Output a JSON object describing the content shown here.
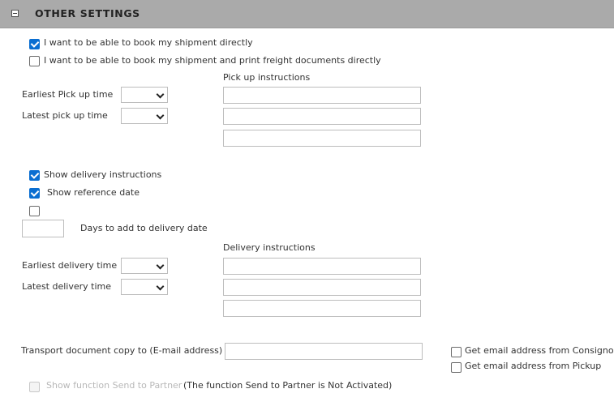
{
  "section": {
    "title": "OTHER SETTINGS",
    "collapse_icon": "minus-square-icon"
  },
  "booking": {
    "book_directly": {
      "label": "I want to be able to book my shipment directly",
      "checked": true
    },
    "book_and_print": {
      "label": "I want to be able to book my shipment and print freight documents directly",
      "checked": false
    }
  },
  "pickup": {
    "earliest_label": "Earliest Pick up time",
    "latest_label": "Latest pick up time",
    "earliest_value": "",
    "latest_value": "",
    "instructions_label": "Pick up instructions",
    "instructions": [
      "",
      "",
      ""
    ]
  },
  "delivery_options": {
    "show_instructions": {
      "label": "Show delivery instructions",
      "checked": true
    },
    "show_reference_date": {
      "label": "Show reference date",
      "checked": true
    },
    "unlabeled_checkbox": {
      "checked": false
    },
    "days_value": "",
    "days_label": "Days to add to delivery date"
  },
  "delivery": {
    "earliest_label": "Earliest delivery time",
    "latest_label": "Latest delivery time",
    "earliest_value": "",
    "latest_value": "",
    "instructions_label": "Delivery instructions",
    "instructions": [
      "",
      "",
      ""
    ]
  },
  "transport": {
    "copy_label": "Transport document copy to  (E-mail address)",
    "email_value": "",
    "consignor": {
      "label": "Get email address from Consignor",
      "checked": false
    },
    "pickup": {
      "label": "Get email address from Pickup",
      "checked": false
    }
  },
  "partner": {
    "label": "Show function Send to Partner",
    "note": "(The function Send to Partner is Not Activated)",
    "checked": false,
    "disabled": true
  },
  "colors": {
    "header_bg": "#aaaaaa",
    "checkbox_accent": "#0a6ed1"
  }
}
